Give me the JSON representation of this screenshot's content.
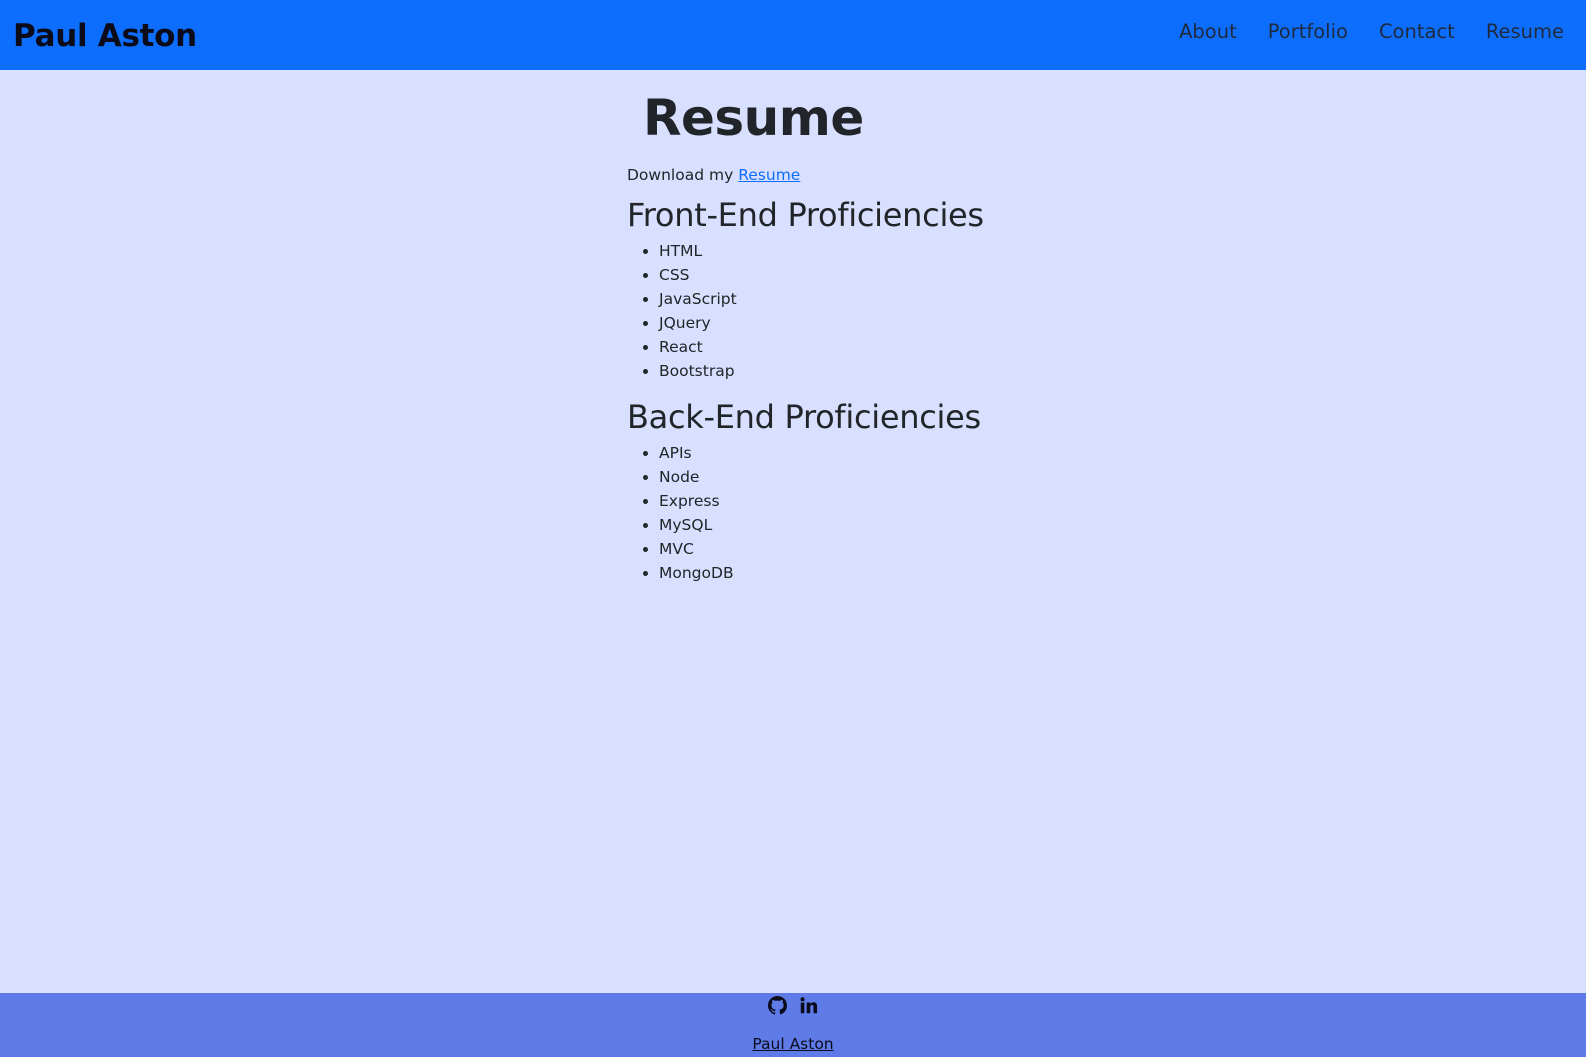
{
  "header": {
    "brand": "Paul Aston",
    "nav": [
      {
        "label": "About"
      },
      {
        "label": "Portfolio"
      },
      {
        "label": "Contact"
      },
      {
        "label": "Resume"
      }
    ]
  },
  "main": {
    "title": "Resume",
    "download_prefix": "Download my",
    "download_link": "Resume",
    "frontend": {
      "title": "Front-End Proficiencies",
      "items": [
        "HTML",
        "CSS",
        "JavaScript",
        "JQuery",
        "React",
        "Bootstrap"
      ]
    },
    "backend": {
      "title": "Back-End Proficiencies",
      "items": [
        "APIs",
        "Node",
        "Express",
        "MySQL",
        "MVC",
        "MongoDB"
      ]
    }
  },
  "footer": {
    "icons": [
      "github-icon",
      "linkedin-icon"
    ],
    "name": "Paul Aston"
  },
  "colors": {
    "navbar": "#0d6efd",
    "background": "#d9e0ff",
    "footer": "#5e7be8",
    "link": "#0d6efd"
  }
}
